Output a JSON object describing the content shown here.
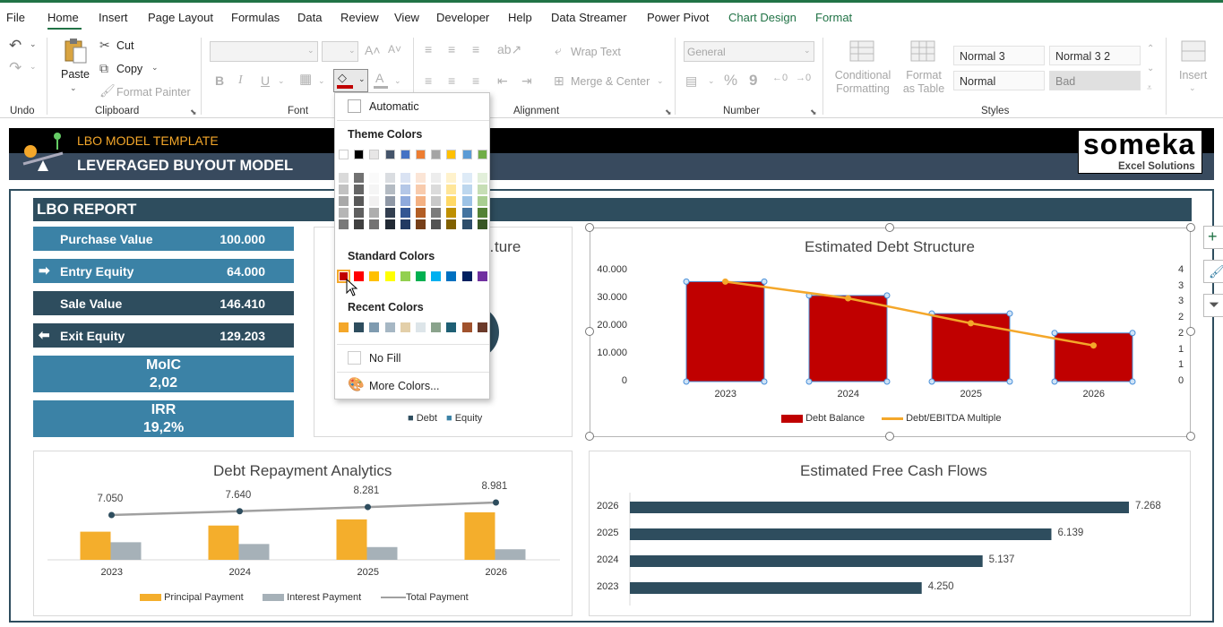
{
  "menu": {
    "tabs": [
      "File",
      "Home",
      "Insert",
      "Page Layout",
      "Formulas",
      "Data",
      "Review",
      "View",
      "Developer",
      "Help",
      "Data Streamer",
      "Power Pivot",
      "Chart Design",
      "Format"
    ],
    "active": "Home"
  },
  "ribbon": {
    "groups": [
      "Undo",
      "Clipboard",
      "Font",
      "Alignment",
      "Number",
      "Styles"
    ],
    "clipboard": {
      "paste": "Paste",
      "cut": "Cut",
      "copy": "Copy",
      "format_painter": "Format Painter"
    },
    "alignment": {
      "wrap_text": "Wrap Text",
      "merge_center": "Merge & Center"
    },
    "number": {
      "format": "General",
      "percent": "%",
      "comma": "9"
    },
    "styles": {
      "conditional": "Conditional Formatting",
      "format_as_table": "Format as Table",
      "cells": [
        "Normal 3",
        "Normal 3 2",
        "Normal",
        "Bad"
      ]
    },
    "cells": {
      "insert": "Insert"
    },
    "font_color_letter": "A"
  },
  "color_menu": {
    "automatic": "Automatic",
    "theme_header": "Theme Colors",
    "standard_header": "Standard Colors",
    "recent_header": "Recent Colors",
    "no_fill": "No Fill",
    "more_colors": "More Colors...",
    "theme_colors": [
      "#ffffff",
      "#000000",
      "#e7e6e6",
      "#44546a",
      "#4472c4",
      "#ed7d31",
      "#a5a5a5",
      "#ffc000",
      "#5b9bd5",
      "#70ad47"
    ],
    "standard_colors": [
      "#c00000",
      "#ff0000",
      "#ffc000",
      "#ffff00",
      "#92d050",
      "#00b050",
      "#00b0f0",
      "#0070c0",
      "#002060",
      "#7030a0"
    ],
    "recent_colors": [
      "#f4a72a",
      "#2e4d5e",
      "#7f9bb0",
      "#a6b7c4",
      "#e3cfa9",
      "#dde5e9",
      "#8aa38c",
      "#1e5f74",
      "#a0522d",
      "#6b3a2a"
    ]
  },
  "banner": {
    "small_title": "LBO MODEL TEMPLATE",
    "title": "LEVERAGED BUYOUT MODEL",
    "logo": "someka",
    "logo_sub": "Excel Solutions"
  },
  "report": {
    "title": "LBO REPORT",
    "kpis": [
      {
        "label": "Purchase Value",
        "value": "100.000"
      },
      {
        "label": "Entry Equity",
        "value": "64.000"
      },
      {
        "label": "Sale Value",
        "value": "146.410"
      },
      {
        "label": "Exit Equity",
        "value": "129.203"
      }
    ],
    "moic": {
      "label": "MoIC",
      "value": "2,02"
    },
    "irr": {
      "label": "IRR",
      "value": "19,2%"
    }
  },
  "chart_data": [
    {
      "type": "pie",
      "title": "…ture",
      "legend": [
        "Debt",
        "Equity"
      ]
    },
    {
      "type": "bar",
      "title": "Estimated Debt Structure",
      "categories": [
        "2023",
        "2024",
        "2025",
        "2026"
      ],
      "series": [
        {
          "name": "Debt Balance",
          "values": [
            36000,
            31000,
            24500,
            17500
          ],
          "color": "#c00000"
        },
        {
          "name": "Debt/EBITDA Multiple",
          "type": "line",
          "values": [
            3.6,
            3.0,
            2.1,
            1.3
          ],
          "color": "#f4a72a"
        }
      ],
      "y_ticks": [
        "40.000",
        "30.000",
        "20.000",
        "10.000",
        "0"
      ],
      "y2_ticks": [
        "4",
        "3",
        "3",
        "2",
        "2",
        "1",
        "1",
        "0"
      ],
      "ylim": [
        0,
        40000
      ],
      "y2lim": [
        0,
        4
      ]
    },
    {
      "type": "bar",
      "title": "Debt Repayment Analytics",
      "categories": [
        "2023",
        "2024",
        "2025",
        "2026"
      ],
      "series": [
        {
          "name": "Principal Payment",
          "values": [
            3200,
            3900,
            4600,
            5400
          ],
          "color": "#f4ae2c"
        },
        {
          "name": "Interest Payment",
          "values": [
            2000,
            1800,
            1450,
            1200
          ],
          "color": "#a6b1b8"
        },
        {
          "name": "Total Payment",
          "type": "line",
          "values": [
            7050,
            7640,
            8281,
            8981
          ],
          "labels": [
            "7.050",
            "7.640",
            "8.281",
            "8.981"
          ],
          "color": "#a0a0a0"
        }
      ]
    },
    {
      "type": "bar",
      "orientation": "horizontal",
      "title": "Estimated Free Cash Flows",
      "categories": [
        "2026",
        "2025",
        "2024",
        "2023"
      ],
      "values": [
        7268,
        6139,
        5137,
        4250
      ],
      "labels": [
        "7.268",
        "6.139",
        "5.137",
        "4.250"
      ],
      "color": "#2e4d5e"
    }
  ]
}
